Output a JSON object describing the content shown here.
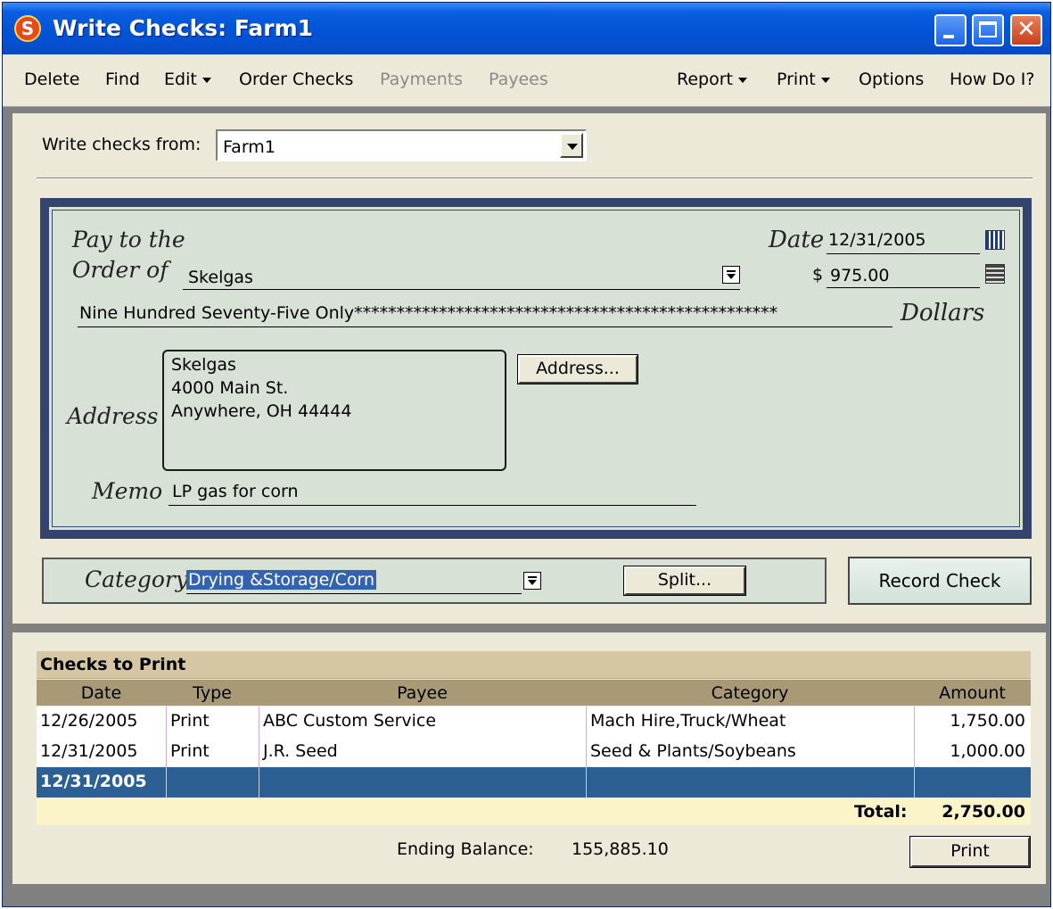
{
  "window": {
    "title": "Write Checks: Farm1"
  },
  "menu": {
    "delete": "Delete",
    "find": "Find",
    "edit": "Edit",
    "order_checks": "Order Checks",
    "payments": "Payments",
    "payees": "Payees",
    "report": "Report",
    "print": "Print",
    "options": "Options",
    "how_do_i": "How Do I?"
  },
  "from": {
    "label": "Write checks from:",
    "account": "Farm1"
  },
  "check": {
    "pay_label_1": "Pay to the",
    "pay_label_2": "Order of",
    "payee": "Skelgas",
    "date_label": "Date",
    "date": "12/31/2005",
    "dollar_sign": "$",
    "amount": "975.00",
    "amount_words": "Nine Hundred Seventy-Five Only**************************************************",
    "dollars_label": "Dollars",
    "address_label": "Address",
    "address_lines": [
      "Skelgas",
      "4000 Main St.",
      "Anywhere, OH 44444"
    ],
    "address_button": "Address...",
    "memo_label": "Memo",
    "memo": "LP gas for corn"
  },
  "category": {
    "label": "Category",
    "value": "Drying &Storage/Corn",
    "split_button": "Split..."
  },
  "record_button": "Record Check",
  "checks_to_print": {
    "title": "Checks to Print",
    "columns": [
      "Date",
      "Type",
      "Payee",
      "Category",
      "Amount"
    ],
    "rows": [
      [
        "12/26/2005",
        "Print",
        "ABC Custom Service",
        "Mach Hire,Truck/Wheat",
        "1,750.00"
      ],
      [
        "12/31/2005",
        "Print",
        "J.R. Seed",
        "Seed & Plants/Soybeans",
        "1,000.00"
      ],
      [
        "12/31/2005",
        "",
        "",
        "",
        ""
      ]
    ],
    "total_label": "Total:",
    "total_value": "2,750.00",
    "ending_balance_label": "Ending Balance:",
    "ending_balance_value": "155,885.10",
    "print_button": "Print"
  },
  "colors": {
    "titlebar": "#0454d8",
    "check_border": "#34446e",
    "check_face": "#d7e1d6",
    "selected_row": "#2c5f94",
    "total_row": "#fbf4c8"
  }
}
